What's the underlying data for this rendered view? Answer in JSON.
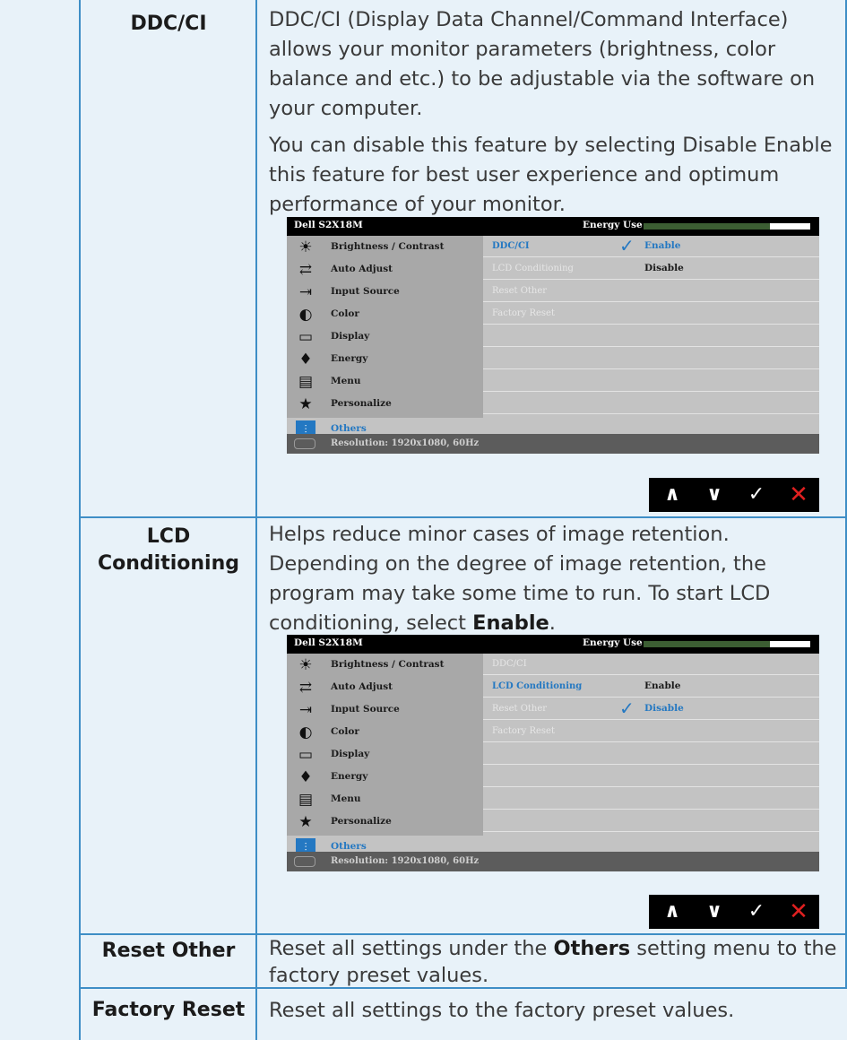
{
  "rows": [
    {
      "label": "DDC/CI",
      "paragraphs": [
        "DDC/CI (Display Data Channel/Command Interface) allows your monitor parameters (brightness, color balance and etc.) to be adjustable via the software on your computer.",
        "You can disable this feature by selecting Disable Enable this feature for best user experience and optimum performance of your monitor."
      ]
    },
    {
      "label_line1": "LCD",
      "label_line2": "Conditioning",
      "text_before_bold": "Helps reduce minor cases of image retention. Depending on the degree of image retention, the program may take some time to run. To start LCD conditioning, select ",
      "bold": "Enable",
      "text_after_bold": "."
    },
    {
      "label": "Reset Other",
      "text_before_bold": "Reset all settings under the ",
      "bold": "Others",
      "text_after_bold": " setting menu to the factory preset values."
    },
    {
      "label": "Factory Reset",
      "text": "Reset all settings to the factory preset values."
    }
  ],
  "osd": {
    "model": "Dell S2X18M",
    "energy_label": "Energy Use",
    "energy_level": 0.76,
    "colors": {
      "energy_fill": "#3c5e33",
      "accent": "#2478c2",
      "close": "#e02020"
    },
    "menu": [
      {
        "label": "Brightness / Contrast",
        "icon": "brightness-icon",
        "glyph": "☀"
      },
      {
        "label": "Auto Adjust",
        "icon": "auto-adjust-icon",
        "glyph": "⇄"
      },
      {
        "label": "Input Source",
        "icon": "input-source-icon",
        "glyph": "⇥"
      },
      {
        "label": "Color",
        "icon": "color-icon",
        "glyph": "◐"
      },
      {
        "label": "Display",
        "icon": "display-icon",
        "glyph": "▭"
      },
      {
        "label": "Energy",
        "icon": "energy-icon",
        "glyph": "♦"
      },
      {
        "label": "Menu",
        "icon": "menu-icon",
        "glyph": "▤"
      },
      {
        "label": "Personalize",
        "icon": "star-icon",
        "glyph": "★"
      },
      {
        "label": "Others",
        "icon": "others-icon",
        "glyph": "⫶"
      }
    ],
    "resolution": "Resolution: 1920x1080, 60Hz",
    "submenu": [
      "DDC/CI",
      "LCD Conditioning",
      "Reset Other",
      "Factory Reset"
    ],
    "value_enable": "Enable",
    "value_disable": "Disable",
    "nav": [
      "up-arrow-icon",
      "down-arrow-icon",
      "check-icon",
      "close-icon"
    ],
    "nav_glyphs": [
      "∧",
      "∨",
      "✓",
      "✕"
    ]
  }
}
